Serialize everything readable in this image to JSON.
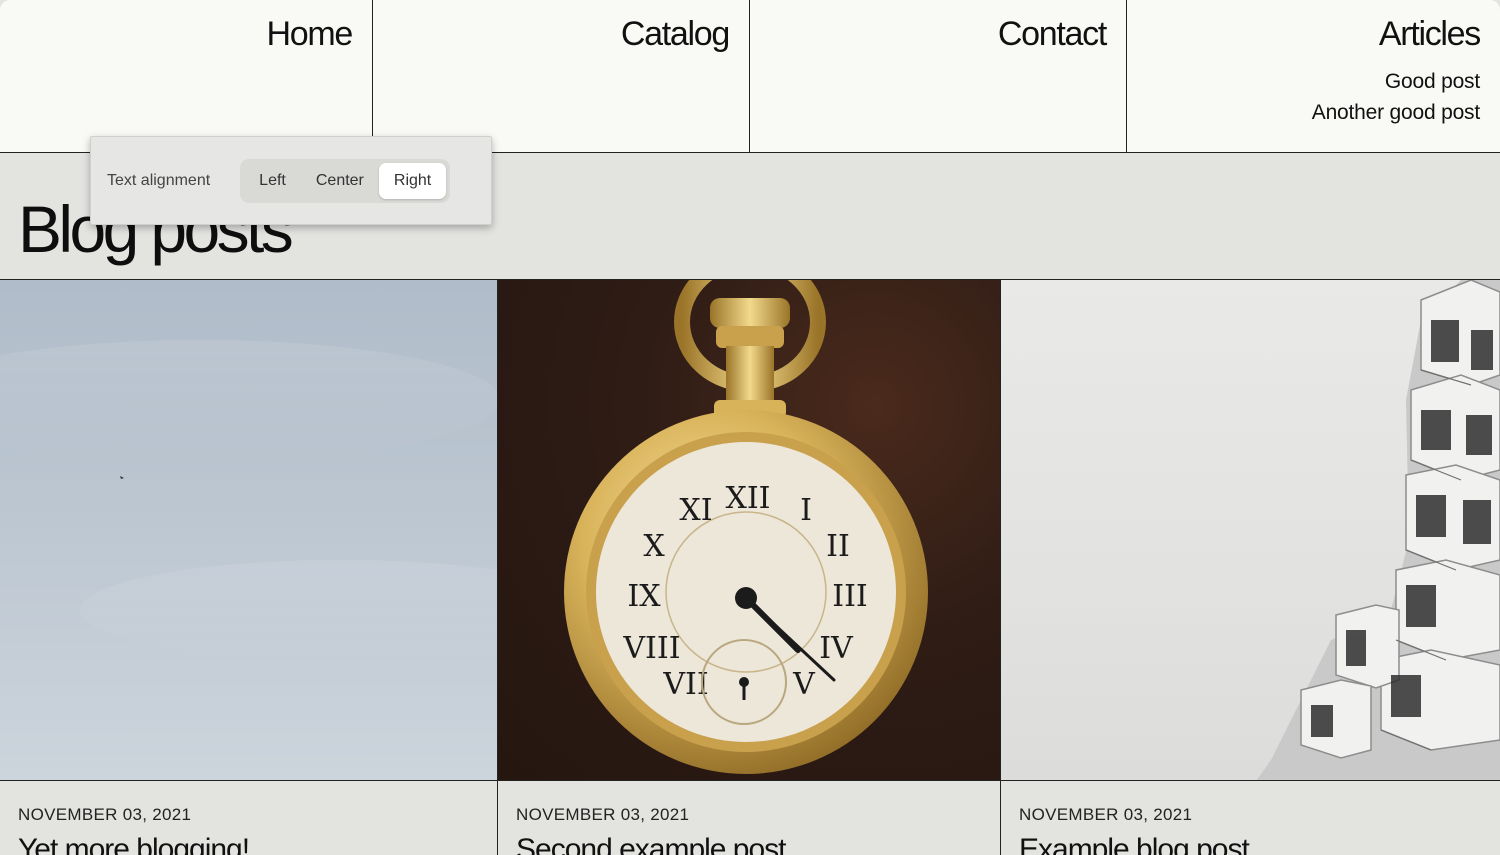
{
  "nav": {
    "items": [
      {
        "label": "Home",
        "children": []
      },
      {
        "label": "Catalog",
        "children": []
      },
      {
        "label": "Contact",
        "children": []
      },
      {
        "label": "Articles",
        "children": [
          "Good post",
          "Another good post"
        ]
      }
    ]
  },
  "page_title": "Blog posts",
  "alignment_popover": {
    "label": "Text alignment",
    "options": [
      "Left",
      "Center",
      "Right"
    ],
    "selected": "Right"
  },
  "posts": [
    {
      "date": "NOVEMBER 03, 2021",
      "title": "Yet more blogging!",
      "image": "sky-photo"
    },
    {
      "date": "NOVEMBER 03, 2021",
      "title": "Second example post",
      "image": "pocket-watch-photo"
    },
    {
      "date": "NOVEMBER 03, 2021",
      "title": "Example blog post",
      "image": "building-photo"
    }
  ],
  "colors": {
    "nav_background": "#f9f9f6",
    "page_background": "#e3e3e0",
    "divider": "#222222"
  }
}
